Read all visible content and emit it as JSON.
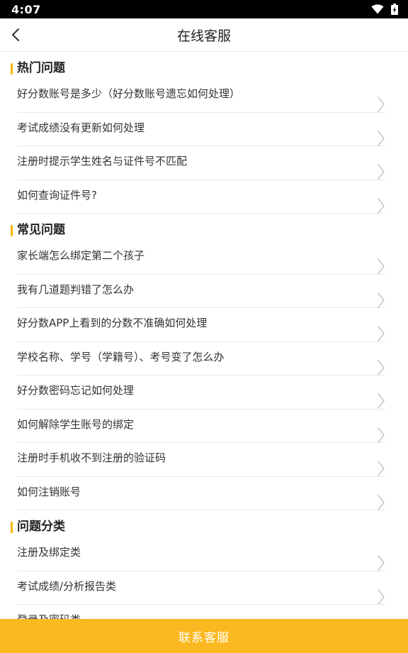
{
  "status_bar": {
    "time": "4:07"
  },
  "nav": {
    "title": "在线客服",
    "back_icon": "chevron-left-icon"
  },
  "sections": [
    {
      "title": "热门问题",
      "items": [
        "好分数账号是多少（好分数账号遗忘如何处理）",
        "考试成绩没有更新如何处理",
        "注册时提示学生姓名与证件号不匹配",
        "如何查询证件号?"
      ]
    },
    {
      "title": "常见问题",
      "items": [
        "家长端怎么绑定第二个孩子",
        "我有几道题判错了怎么办",
        "好分数APP上看到的分数不准确如何处理",
        "学校名称、学号（学籍号）、考号变了怎么办",
        "好分数密码忘记如何处理",
        "如何解除学生账号的绑定",
        "注册时手机收不到注册的验证码",
        "如何注销账号"
      ]
    },
    {
      "title": "问题分类",
      "items": [
        "注册及绑定类",
        "考试成绩/分析报告类",
        "登录及密码类"
      ]
    }
  ],
  "contact_button": {
    "label": "联系客服"
  },
  "colors": {
    "accent": "#f7b500",
    "button": "#fbb921",
    "divider": "#e8e8e8"
  }
}
